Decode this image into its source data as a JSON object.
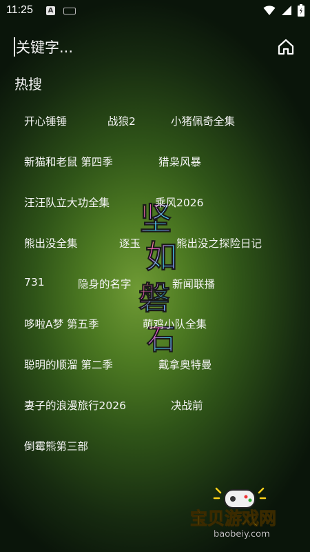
{
  "status": {
    "time": "11:25",
    "keyboard_badge": "A"
  },
  "search": {
    "placeholder": "关键字..."
  },
  "section": {
    "title": "热搜"
  },
  "hot_searches": [
    {
      "label": "开心锤锤"
    },
    {
      "label": "战狼2"
    },
    {
      "label": "小猪佩奇全集"
    },
    {
      "label": "新猫和老鼠 第四季"
    },
    {
      "label": "猎枭风暴"
    },
    {
      "label": "汪汪队立大功全集"
    },
    {
      "label": "乘风2026"
    },
    {
      "label": "熊出没全集"
    },
    {
      "label": "逐玉"
    },
    {
      "label": "熊出没之探险日记"
    },
    {
      "label": "731"
    },
    {
      "label": "隐身的名字"
    },
    {
      "label": "新闻联播"
    },
    {
      "label": "哆啦A梦 第五季"
    },
    {
      "label": "萌鸡小队全集"
    },
    {
      "label": "聪明的顺溜 第二季"
    },
    {
      "label": "戴拿奥特曼"
    },
    {
      "label": "妻子的浪漫旅行2026"
    },
    {
      "label": "决战前"
    },
    {
      "label": "倒霉熊第三部"
    }
  ],
  "background_art": {
    "chars": [
      "坚",
      "如",
      "磐",
      "石"
    ]
  },
  "watermark": {
    "brand": "宝贝游戏网",
    "domain": "baobeiy.com"
  },
  "colors": {
    "accent_art": [
      "#ff5ad1",
      "#3fe0ff",
      "#b46bff",
      "#ffe14a"
    ],
    "watermark_text": "#ffd21a"
  }
}
